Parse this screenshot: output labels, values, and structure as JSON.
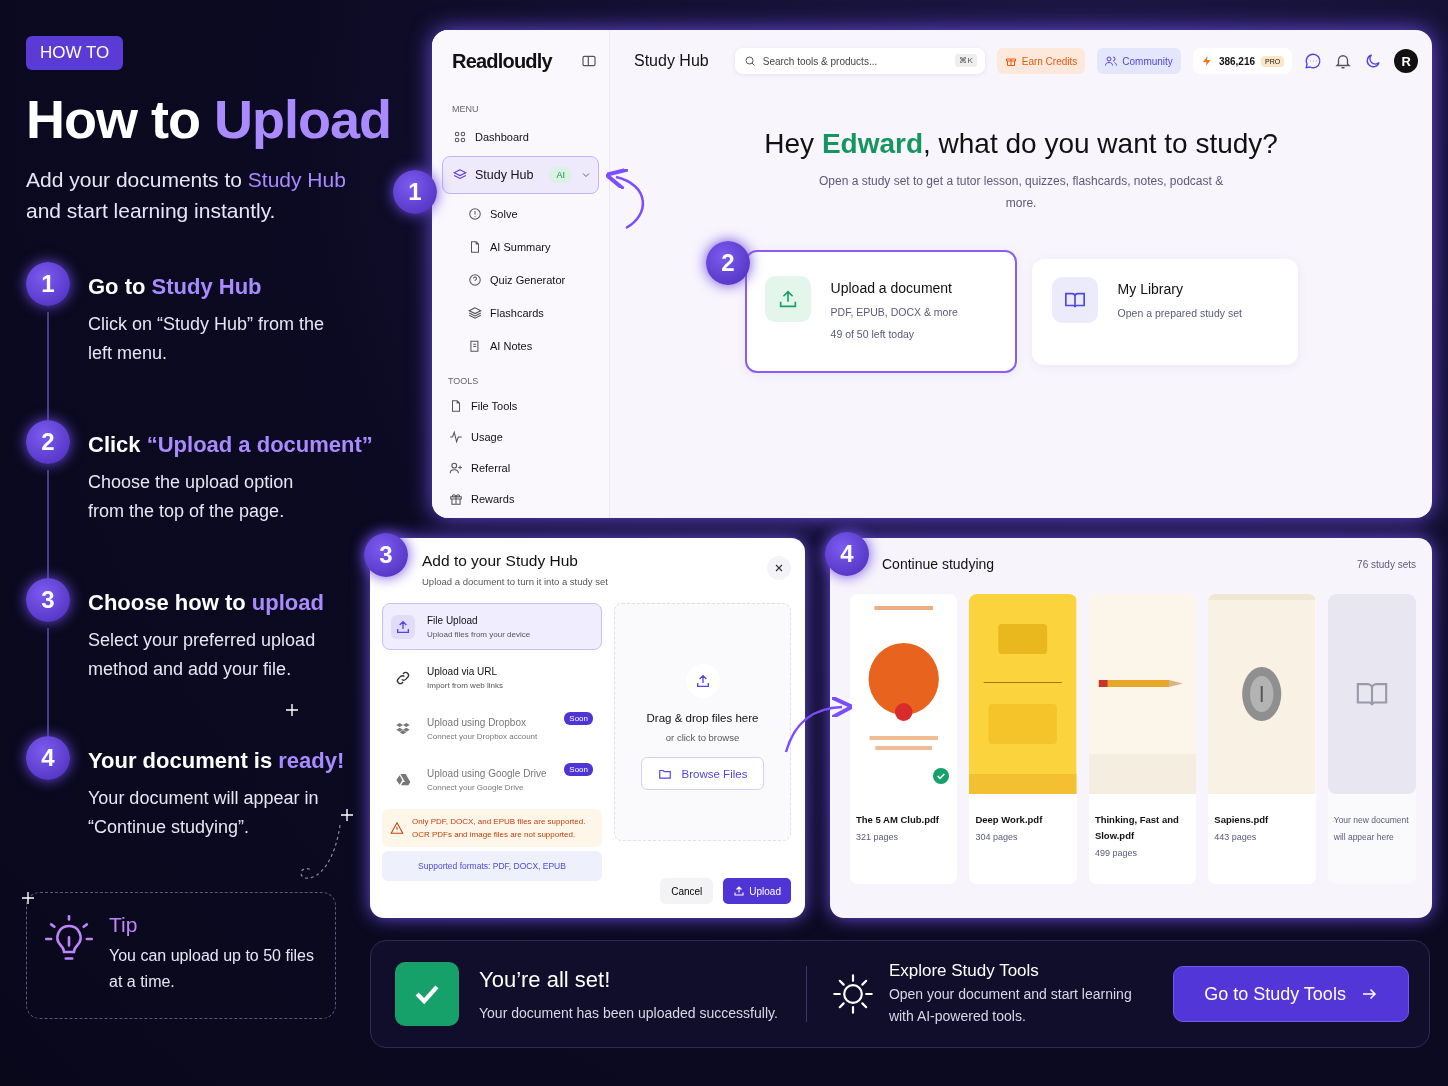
{
  "badge": "HOW TO",
  "title": {
    "plain": "How to ",
    "accent": "Upload"
  },
  "subtitle": {
    "before": "Add your documents to ",
    "accent": "Study Hub",
    "after": " and start learning instantly."
  },
  "steps": [
    {
      "number": "1",
      "title": "Go to ",
      "accent": "Study Hub",
      "text": "Click on “Study Hub” from the left menu."
    },
    {
      "number": "2",
      "title": "Click ",
      "accent": "“Upload a document”",
      "text": "Choose the upload option from the top of the page."
    },
    {
      "number": "3",
      "title": "Choose how to ",
      "accent": "upload",
      "text": "Select your preferred upload method and add your file."
    },
    {
      "number": "4",
      "title": "Your document is ",
      "accent": "ready!",
      "text": "Your document will appear in “Continue studying”."
    }
  ],
  "tip": {
    "title": "Tip",
    "text": "You can upload up to 50 files at a time."
  },
  "callouts": [
    "1",
    "2",
    "3",
    "4"
  ],
  "app": {
    "logo": "Readloudly",
    "page_title": "Study Hub",
    "search": {
      "placeholder": "Search tools & products...",
      "shortcut": "⌘K"
    },
    "earn": "Earn Credits",
    "community": "Community",
    "credits": "386,216",
    "plan": "PRO",
    "avatar": "R"
  },
  "sidebar": {
    "menu_label": "MENU",
    "menu": [
      {
        "label": "Dashboard",
        "selected": false
      },
      {
        "label": "Study Hub",
        "selected": true,
        "badge": "AI",
        "expanded": true,
        "children": [
          {
            "label": "Solve",
            "selected": false
          },
          {
            "label": "AI Summary",
            "selected": false
          },
          {
            "label": "Quiz Generator",
            "selected": false
          },
          {
            "label": "Flashcards",
            "selected": false
          },
          {
            "label": "AI Notes",
            "selected": false
          }
        ]
      }
    ],
    "tools_label": "TOOLS",
    "tools": [
      {
        "label": "File Tools",
        "selected": false
      },
      {
        "label": "Usage",
        "selected": false
      },
      {
        "label": "Referral",
        "selected": false
      },
      {
        "label": "Rewards",
        "selected": false
      }
    ]
  },
  "greeting": {
    "before": "Hey ",
    "name": "Edward",
    "after": ", what do you want to study?"
  },
  "intro": "Open a study set to get a tutor lesson, quizzes, flashcards, notes, podcast & more.",
  "cards": [
    {
      "title": "Upload a document",
      "lines": [
        "PDF, EPUB, DOCX & more",
        "49 of 50 left today"
      ],
      "selected": true
    },
    {
      "title": "My Library",
      "lines": [
        "Open a prepared study set"
      ],
      "selected": false
    }
  ],
  "dialog": {
    "title": "Add to your Study Hub",
    "subtitle": "Upload a document to turn it into a study set",
    "options": [
      {
        "title": "File Upload",
        "desc": "Upload files from your device",
        "selected": true,
        "disabled": false
      },
      {
        "title": "Upload via URL",
        "desc": "Import from web links",
        "selected": false,
        "disabled": false
      },
      {
        "title": "Upload using Dropbox",
        "desc": "Connect your Dropbox account",
        "selected": false,
        "disabled": true,
        "badge": "Soon"
      },
      {
        "title": "Upload using Google Drive",
        "desc": "Connect your Google Drive",
        "selected": false,
        "disabled": true,
        "badge": "Soon"
      }
    ],
    "warning": "Only PDF, DOCX, and EPUB files are supported. OCR PDFs and image files are not supported.",
    "formats": "Supported formats: PDF, DOCX, EPUB",
    "drop_title": "Drag & drop files here",
    "drop_hint": "or click to browse",
    "browse": "Browse Files",
    "cancel": "Cancel",
    "upload": "Upload"
  },
  "continue": {
    "title": "Continue studying",
    "count": "76 study sets",
    "books": [
      {
        "name": "The 5 AM Club.pdf",
        "pages": "321 pages",
        "done": true
      },
      {
        "name": "Deep Work.pdf",
        "pages": "304 pages",
        "done": false
      },
      {
        "name": "Thinking, Fast and Slow.pdf",
        "pages": "499 pages",
        "done": false
      },
      {
        "name": "Sapiens.pdf",
        "pages": "443 pages",
        "done": false
      }
    ],
    "placeholder": "Your new document will appear here"
  },
  "done_bar": {
    "title": "You’re all set!",
    "text": "Your document has been uploaded successfully.",
    "explore_title": "Explore Study Tools",
    "explore_text": "Open your document and start learning with AI-powered tools.",
    "cta": "Go to Study Tools"
  }
}
